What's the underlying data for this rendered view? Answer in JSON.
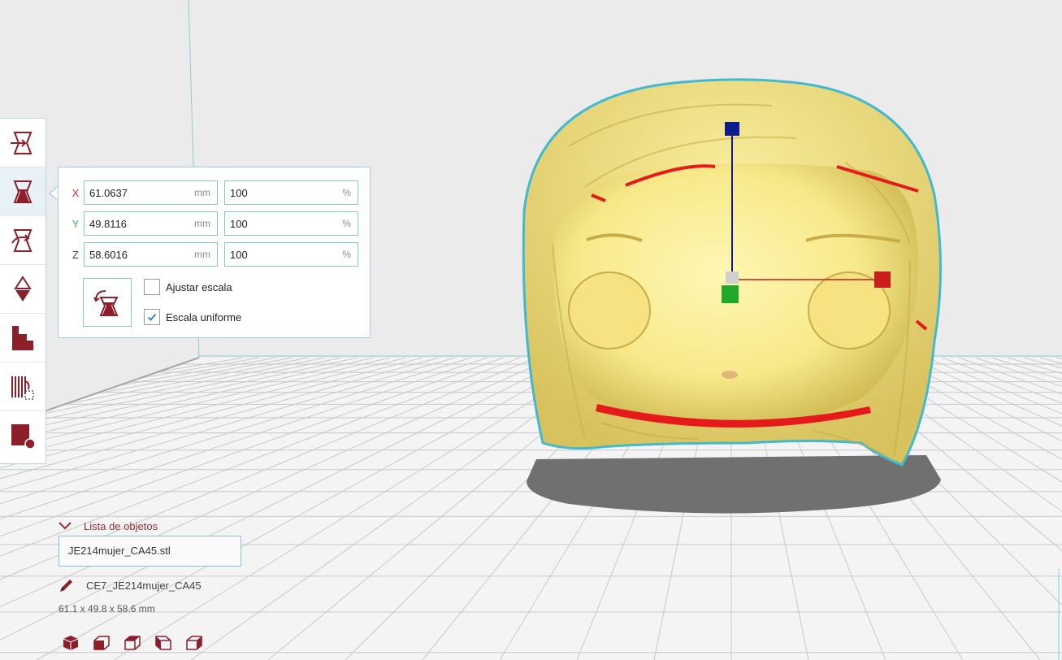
{
  "scale_panel": {
    "rows": [
      {
        "axis": "X",
        "axis_color": "#d0343b",
        "mm_value": "61.0637",
        "mm_unit": "mm",
        "pct_value": "100",
        "pct_unit": "%"
      },
      {
        "axis": "Y",
        "axis_color": "#36b04a",
        "mm_value": "49.8116",
        "mm_unit": "mm",
        "pct_value": "100",
        "pct_unit": "%"
      },
      {
        "axis": "Z",
        "axis_color": "#444444",
        "mm_value": "58.6016",
        "mm_unit": "mm",
        "pct_value": "100",
        "pct_unit": "%"
      }
    ],
    "fit_scale": {
      "label": "Ajustar escala",
      "checked": false
    },
    "uniform_scale": {
      "label": "Escala uniforme",
      "checked": true
    }
  },
  "toolbar": {
    "tools": [
      {
        "name": "move",
        "icon": "move-tool-icon",
        "active": false
      },
      {
        "name": "scale",
        "icon": "scale-tool-icon",
        "active": true
      },
      {
        "name": "rotate",
        "icon": "rotate-tool-icon",
        "active": false
      },
      {
        "name": "mirror",
        "icon": "mirror-tool-icon",
        "active": false
      },
      {
        "name": "per-model-settings",
        "icon": "per-model-settings-icon",
        "active": false
      },
      {
        "name": "support-blocker",
        "icon": "support-blocker-icon",
        "active": false
      },
      {
        "name": "custom",
        "icon": "custom-tool-icon",
        "active": false
      }
    ]
  },
  "object_list": {
    "header": "Lista de objetos",
    "items": [
      "JE214mujer_CA45.stl"
    ]
  },
  "job_name": "CE7_JE214mujer_CA45",
  "dimensions": "61.1 x 49.8 x 58.6 mm",
  "view_buttons": [
    "3d-view-icon",
    "front-view-icon",
    "top-view-icon",
    "left-view-icon",
    "right-view-icon"
  ],
  "colors": {
    "accent": "#8b1f2a",
    "panel_border": "#89c2d8",
    "model_fill": "#f7e98a",
    "model_outline": "#42b9cf",
    "overhang": "#e51b1b",
    "gizmo_x": "#c81e1e",
    "gizmo_y": "#1fa82a",
    "gizmo_z": "#0c1c8c"
  }
}
